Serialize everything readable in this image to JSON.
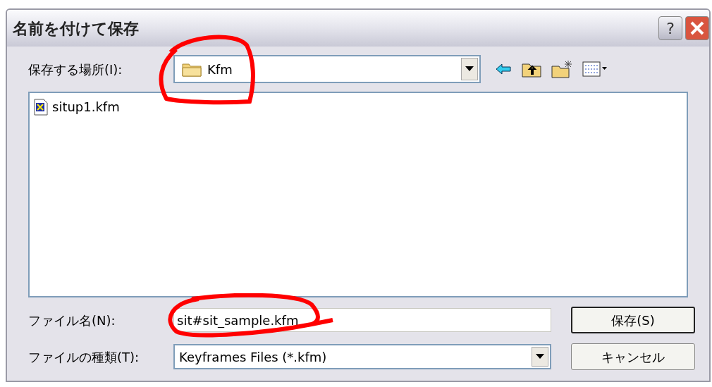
{
  "window": {
    "title": "名前を付けて保存",
    "help": "?"
  },
  "location": {
    "label": "保存する場所(I):",
    "value": "Kfm"
  },
  "files": [
    {
      "name": "situp1.kfm",
      "selected": false
    }
  ],
  "file_name": {
    "label": "ファイル名(N):",
    "value": "sit#sit_sample.kfm"
  },
  "file_type": {
    "label": "ファイルの種類(T):",
    "value": "Keyframes Files (*.kfm)"
  },
  "buttons": [
    {
      "label": "保存(S)",
      "default": true
    },
    {
      "label": "キャンセル",
      "default": false
    }
  ]
}
